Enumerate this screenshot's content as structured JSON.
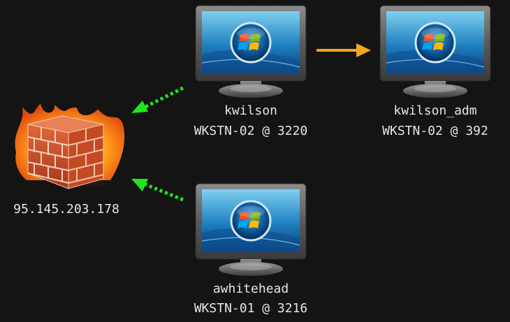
{
  "firewall": {
    "ip": "95.145.203.178"
  },
  "hosts": [
    {
      "user": "kwilson",
      "session": "WKSTN-02 @ 3220"
    },
    {
      "user": "kwilson_adm",
      "session": "WKSTN-02 @ 392"
    },
    {
      "user": "awhitehead",
      "session": "WKSTN-01 @ 3216"
    }
  ],
  "colors": {
    "background": "#141414",
    "beacon_arrow": "#1ee61e",
    "session_arrow": "#f5a623",
    "text": "#e6e6e6"
  }
}
